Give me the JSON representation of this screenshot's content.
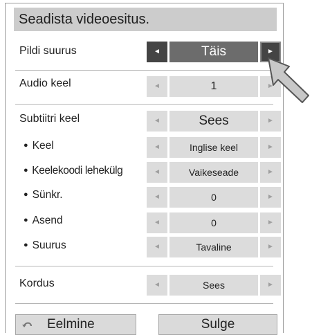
{
  "dialog": {
    "title": "Seadista videoesitus."
  },
  "rows": [
    {
      "label": "Pildi suurus",
      "value": "Täis"
    },
    {
      "label": "Audio keel",
      "value": "1"
    },
    {
      "label": "Subtiitri keel",
      "value": "Sees"
    },
    {
      "label": "Keel",
      "value": "Inglise keel"
    },
    {
      "label": "Keelekoodi lehekülg",
      "value": "Vaikeseade"
    },
    {
      "label": "Sünkr.",
      "value": "0"
    },
    {
      "label": "Asend",
      "value": "0"
    },
    {
      "label": "Suurus",
      "value": "Tavaline"
    },
    {
      "label": "Kordus",
      "value": "Sees"
    }
  ],
  "arrows": {
    "left": "◄",
    "right": "►"
  },
  "buttons": {
    "previous": {
      "label": "Eelmine",
      "icon": "return-icon"
    },
    "close": {
      "label": "Sulge"
    }
  }
}
